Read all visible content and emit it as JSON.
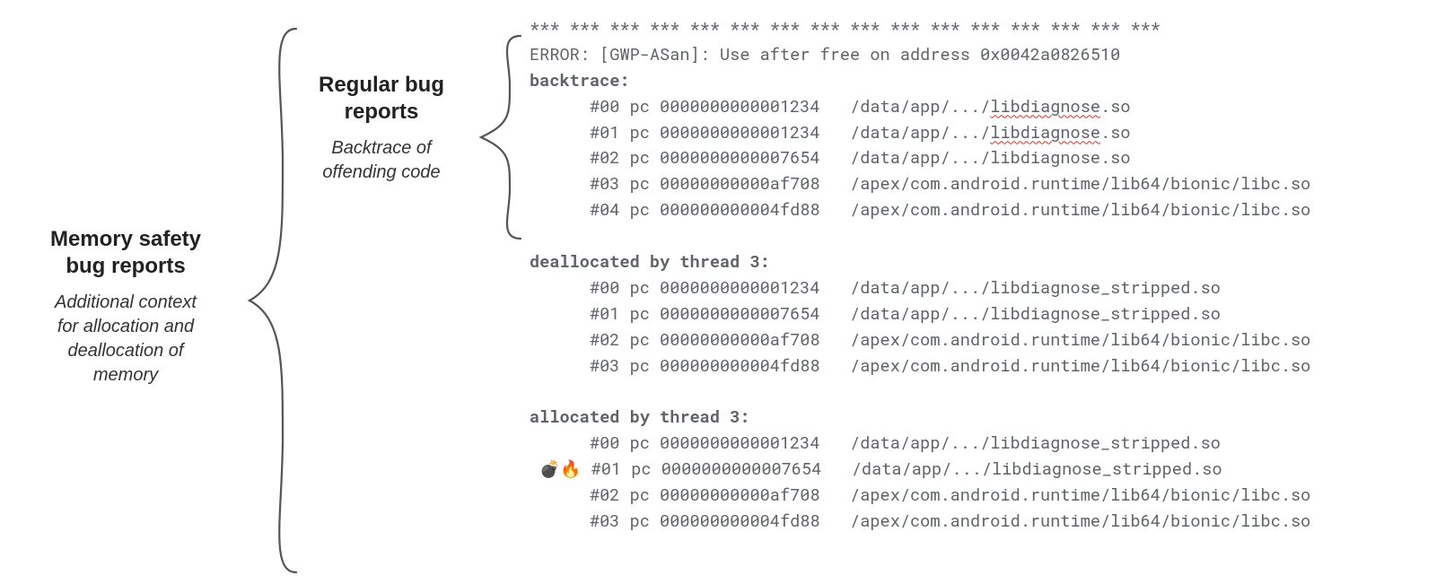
{
  "left": {
    "title1": "Memory safety",
    "title2": "bug reports",
    "sub1": "Additional context",
    "sub2": "for allocation and",
    "sub3": "deallocation of",
    "sub4": "memory"
  },
  "right": {
    "title1": "Regular bug",
    "title2": "reports",
    "sub1": "Backtrace of",
    "sub2": "offending code"
  },
  "marker_emoji": "💣🔥",
  "code": {
    "stars": "*** *** *** *** *** *** *** *** *** *** *** *** *** *** *** ***",
    "error": "ERROR: [GWP-ASan]: Use after free on address 0x0042a0826510",
    "bt_header": "backtrace:",
    "bt": [
      {
        "idx": "#00",
        "pc": "pc 0000000000001234",
        "path_pre": "/data/app/.../",
        "lib": "libdiagnose",
        "ext": ".so",
        "sq": true
      },
      {
        "idx": "#01",
        "pc": "pc 0000000000001234",
        "path_pre": "/data/app/.../",
        "lib": "libdiagnose",
        "ext": ".so",
        "sq": true
      },
      {
        "idx": "#02",
        "pc": "pc 0000000000007654",
        "path_pre": "/data/app/.../",
        "lib": "libdiagnose",
        "ext": ".so",
        "sq": false
      },
      {
        "idx": "#03",
        "pc": "pc 00000000000af708",
        "path_pre": "/apex/com.android.runtime/lib64/bionic/",
        "lib": "libc",
        "ext": ".so",
        "sq": false
      },
      {
        "idx": "#04",
        "pc": "pc 000000000004fd88",
        "path_pre": "/apex/com.android.runtime/lib64/bionic/",
        "lib": "libc",
        "ext": ".so",
        "sq": false
      }
    ],
    "dealloc_header": "deallocated by thread 3:",
    "dealloc": [
      {
        "idx": "#00",
        "pc": "pc 0000000000001234",
        "path": "/data/app/.../libdiagnose_stripped.so"
      },
      {
        "idx": "#01",
        "pc": "pc 0000000000007654",
        "path": "/data/app/.../libdiagnose_stripped.so"
      },
      {
        "idx": "#02",
        "pc": "pc 00000000000af708",
        "path": "/apex/com.android.runtime/lib64/bionic/libc.so"
      },
      {
        "idx": "#03",
        "pc": "pc 000000000004fd88",
        "path": "/apex/com.android.runtime/lib64/bionic/libc.so"
      }
    ],
    "alloc_header": "allocated by thread 3:",
    "alloc": [
      {
        "m": "   ",
        "idx": "#00",
        "pc": "pc 0000000000001234",
        "path": "/data/app/.../libdiagnose_stripped.so"
      },
      {
        "m": "emoji",
        "idx": "#01",
        "pc": "pc 0000000000007654",
        "path": "/data/app/.../libdiagnose_stripped.so"
      },
      {
        "m": "   ",
        "idx": "#02",
        "pc": "pc 00000000000af708",
        "path": "/apex/com.android.runtime/lib64/bionic/libc.so"
      },
      {
        "m": "   ",
        "idx": "#03",
        "pc": "pc 000000000004fd88",
        "path": "/apex/com.android.runtime/lib64/bionic/libc.so"
      }
    ]
  }
}
